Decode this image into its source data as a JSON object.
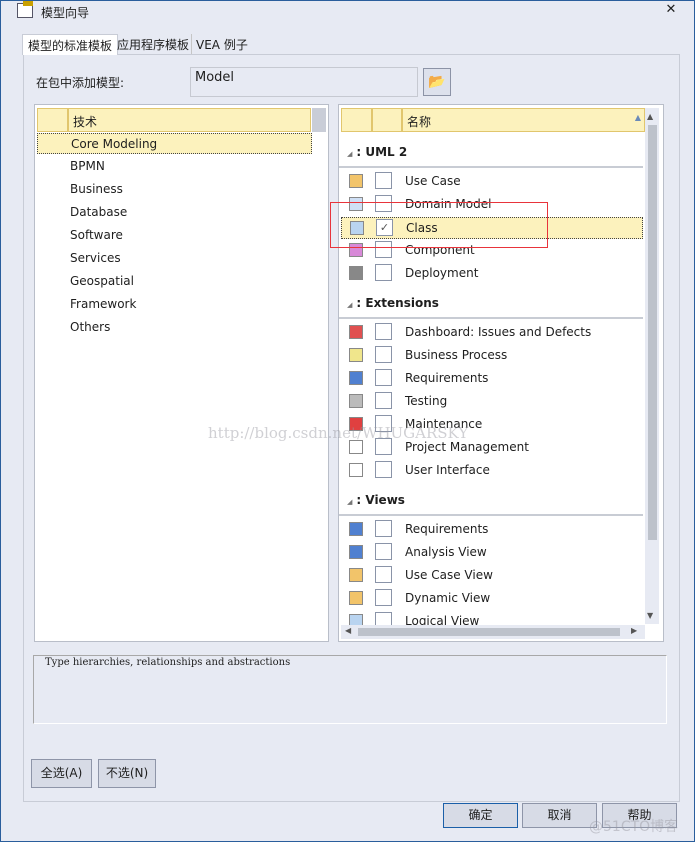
{
  "window": {
    "title": "模型向导",
    "close": "✕",
    "icon": "model-wizard-icon"
  },
  "tabs": [
    "模型的标准模板",
    "应用程序模板",
    "VEA 例子"
  ],
  "package": {
    "label": "在包中添加模型:",
    "value": "Model",
    "browse_icon": "folder-icon"
  },
  "left_list": {
    "header": "技术",
    "items": [
      "Core Modeling",
      "BPMN",
      "Business",
      "Database",
      "Software",
      "Services",
      "Geospatial",
      "Framework",
      "Others"
    ],
    "selected": "Core Modeling"
  },
  "right_list": {
    "header": "名称",
    "groups": [
      {
        "name": ": UML 2",
        "items": [
          {
            "label": "Use Case",
            "checked": false,
            "icon": "use-case-icon"
          },
          {
            "label": "Domain Model",
            "checked": false,
            "icon": "domain-model-icon"
          },
          {
            "label": "Class",
            "checked": true,
            "icon": "class-icon"
          },
          {
            "label": "Component",
            "checked": false,
            "icon": "component-icon"
          },
          {
            "label": "Deployment",
            "checked": false,
            "icon": "deployment-icon"
          }
        ]
      },
      {
        "name": ": Extensions",
        "items": [
          {
            "label": "Dashboard: Issues and Defects",
            "checked": false,
            "icon": "dashboard-icon"
          },
          {
            "label": "Business Process",
            "checked": false,
            "icon": "business-process-icon"
          },
          {
            "label": "Requirements",
            "checked": false,
            "icon": "requirements-icon"
          },
          {
            "label": "Testing",
            "checked": false,
            "icon": "testing-icon"
          },
          {
            "label": "Maintenance",
            "checked": false,
            "icon": "maintenance-icon"
          },
          {
            "label": "Project Management",
            "checked": false,
            "icon": "document-icon"
          },
          {
            "label": "User Interface",
            "checked": false,
            "icon": "document-icon"
          }
        ]
      },
      {
        "name": ": Views",
        "items": [
          {
            "label": "Requirements",
            "checked": false,
            "icon": "requirements-icon"
          },
          {
            "label": "Analysis View",
            "checked": false,
            "icon": "analysis-icon"
          },
          {
            "label": "Use Case View",
            "checked": false,
            "icon": "use-case-icon"
          },
          {
            "label": "Dynamic View",
            "checked": false,
            "icon": "use-case-icon"
          },
          {
            "label": "Logical View",
            "checked": false,
            "icon": "class-icon"
          }
        ]
      }
    ]
  },
  "description": "Type hierarchies, relationships and abstractions",
  "buttons": {
    "select_all": "全选(A)",
    "select_none": "不选(N)",
    "ok": "确定",
    "cancel": "取消",
    "help": "帮助"
  },
  "watermarks": [
    "http://blog.csdn.net/WHUGARSKY",
    "@51CTO博客"
  ]
}
